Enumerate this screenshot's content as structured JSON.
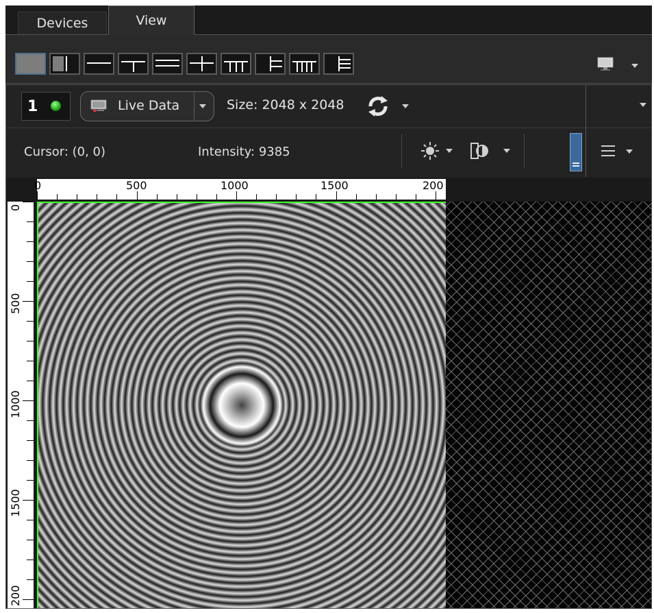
{
  "tabs": [
    {
      "label": "Devices"
    },
    {
      "label": "View"
    }
  ],
  "layout_toolbar": {
    "buttons": [
      {
        "name": "single"
      },
      {
        "name": "split-vertical"
      },
      {
        "name": "split-horizontal"
      },
      {
        "name": "one-top-two-bottom"
      },
      {
        "name": "three-rows"
      },
      {
        "name": "two-by-two"
      },
      {
        "name": "one-top-four-bottom"
      },
      {
        "name": "left-plus-three-right"
      },
      {
        "name": "one-top-five-bottom"
      },
      {
        "name": "left-plus-four-right"
      }
    ],
    "active_index": 0
  },
  "viewer": {
    "channel_number": "1",
    "source_label": "Live Data",
    "size_text": "Size: 2048 x 2048",
    "cursor_text": "Cursor: (0, 0)",
    "intensity_text": "Intensity: 9385"
  },
  "ruler": {
    "top_labels": [
      "0",
      "500",
      "1000",
      "1500",
      "200"
    ],
    "left_labels": [
      "0",
      "500",
      "1000",
      "1500",
      "200"
    ]
  },
  "colors": {
    "background": "#1b1b1b",
    "accent": "#3b6a9a",
    "status_green": "#1fa21a",
    "roi_border": "#3cff2a"
  },
  "icons": {
    "monitor": "monitor-icon",
    "refresh": "refresh-icon",
    "brightness": "brightness-icon",
    "contrast": "contrast-icon",
    "menu": "menu-icon"
  }
}
